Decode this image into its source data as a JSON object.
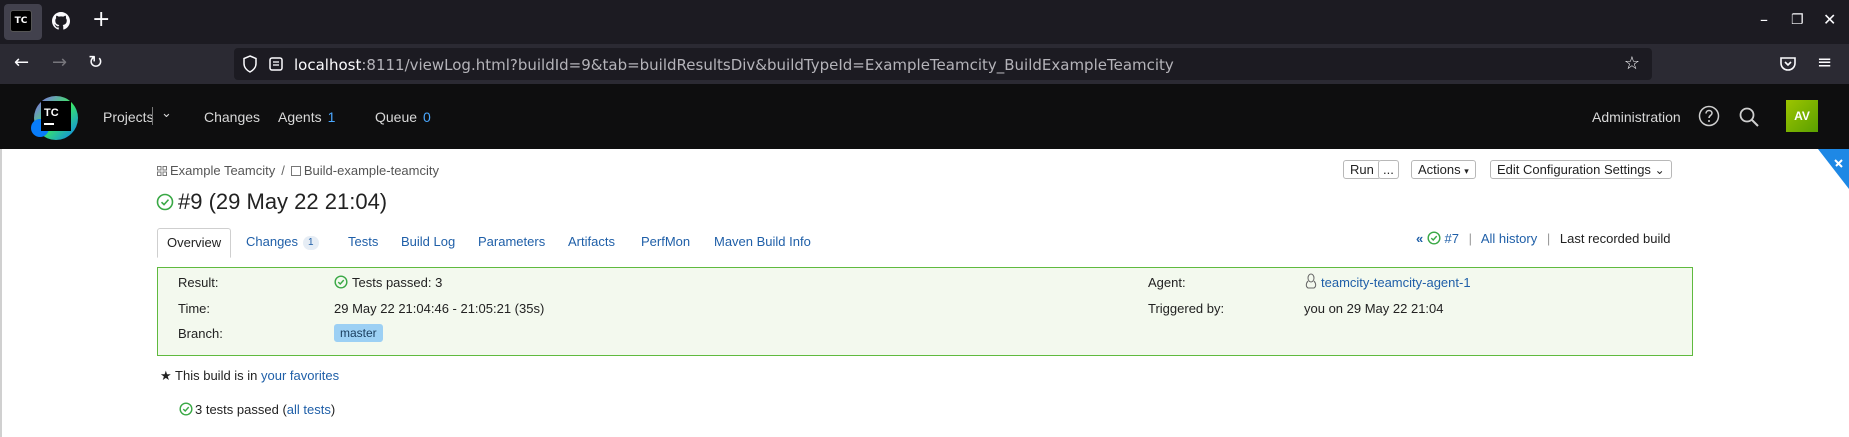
{
  "browser": {
    "favicon_text": "TC",
    "new_tab_glyph": "+",
    "url_host": "localhost",
    "url_rest": ":8111/viewLog.html?buildId=9&tab=buildResultsDiv&buildTypeId=ExampleTeamcity_BuildExampleTeamcity",
    "window_controls": [
      "–",
      "❐",
      "✕"
    ]
  },
  "header": {
    "logo_text": "TC",
    "nav": {
      "projects": "Projects",
      "changes": "Changes",
      "agents": "Agents",
      "agents_count": "1",
      "queue": "Queue",
      "queue_count": "0"
    },
    "administration": "Administration",
    "avatar_initials": "AV"
  },
  "breadcrumb": {
    "project": "Example Teamcity",
    "separator": "/",
    "config": "Build-example-teamcity"
  },
  "build": {
    "title": "#9 (29 May 22 21:04)"
  },
  "actions": {
    "run": "Run",
    "more": "...",
    "actions": "Actions",
    "edit_config": "Edit Configuration Settings"
  },
  "tabs": {
    "overview": "Overview",
    "changes": "Changes",
    "changes_count": "1",
    "tests": "Tests",
    "build_log": "Build Log",
    "parameters": "Parameters",
    "artifacts": "Artifacts",
    "perfmon": "PerfMon",
    "maven": "Maven Build Info"
  },
  "history": {
    "prev_build": "#7",
    "all_history": "All history",
    "sep": "|",
    "last_recorded": "Last recorded build"
  },
  "results": {
    "result_label": "Result:",
    "result_value": "Tests passed: 3",
    "time_label": "Time:",
    "time_value": "29 May 22 21:04:46 - 21:05:21 (35s)",
    "branch_label": "Branch:",
    "branch_value": "master",
    "agent_label": "Agent:",
    "agent_value": "teamcity-teamcity-agent-1",
    "triggered_label": "Triggered by:",
    "triggered_value": "you on 29 May 22 21:04"
  },
  "favorites": {
    "prefix": "This build is in ",
    "link": "your favorites"
  },
  "tests_summary": {
    "prefix": "3 tests passed (",
    "link": "all tests",
    "suffix": ")"
  },
  "colors": {
    "link": "#1f5fa8",
    "success": "#39a845",
    "results_border": "#5fba3e",
    "results_bg": "#f3f9ee"
  }
}
